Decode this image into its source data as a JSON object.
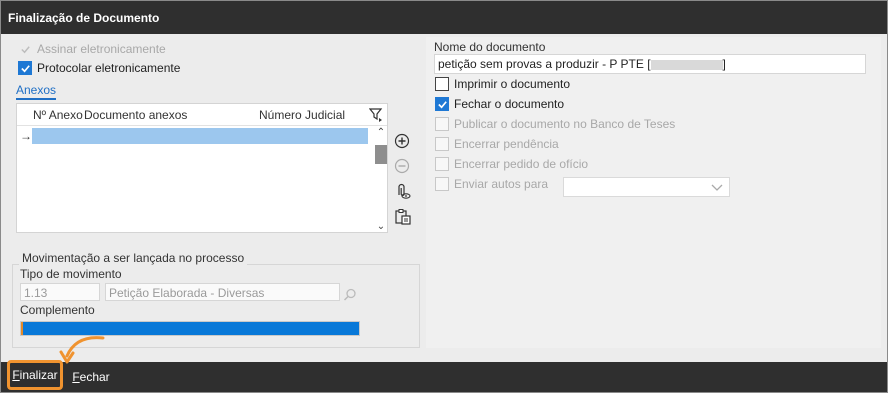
{
  "window": {
    "title": "Finalização de Documento"
  },
  "left": {
    "sign_label": "Assinar eletronicamente",
    "protocol_label": "Protocolar eletronicamente",
    "tab_label": "Anexos",
    "columns": [
      "Nº Anexo",
      "Documento anexos",
      "Número Judicial"
    ],
    "group_title": "Movimentação a ser lançada no processo",
    "tipo_label": "Tipo de movimento",
    "tipo_code": "1.13",
    "tipo_desc": "Petição Elaborada - Diversas",
    "complemento_label": "Complemento",
    "complemento_progress": 1.0
  },
  "right": {
    "doc_name_label": "Nome do documento",
    "doc_name_value": "petição sem provas a produzir - P PTE [",
    "doc_name_end": "]",
    "options": [
      {
        "label": "Imprimir o documento",
        "checked": false,
        "enabled": true
      },
      {
        "label": "Fechar o documento",
        "checked": true,
        "enabled": true
      },
      {
        "label": "Publicar o documento no Banco de Teses",
        "checked": false,
        "enabled": false
      },
      {
        "label": "Encerrar pendência",
        "checked": false,
        "enabled": false
      },
      {
        "label": "Encerrar pedido de ofício",
        "checked": false,
        "enabled": false
      },
      {
        "label": "Enviar autos para",
        "checked": false,
        "enabled": false
      }
    ]
  },
  "footer": {
    "finalizar_first": "F",
    "finalizar_rest": "inalizar",
    "fechar_first": "F",
    "fechar_rest": "echar"
  },
  "colors": {
    "accent": "#1e78d4",
    "highlight": "#f0932f",
    "bar": "#2f2f2f"
  }
}
